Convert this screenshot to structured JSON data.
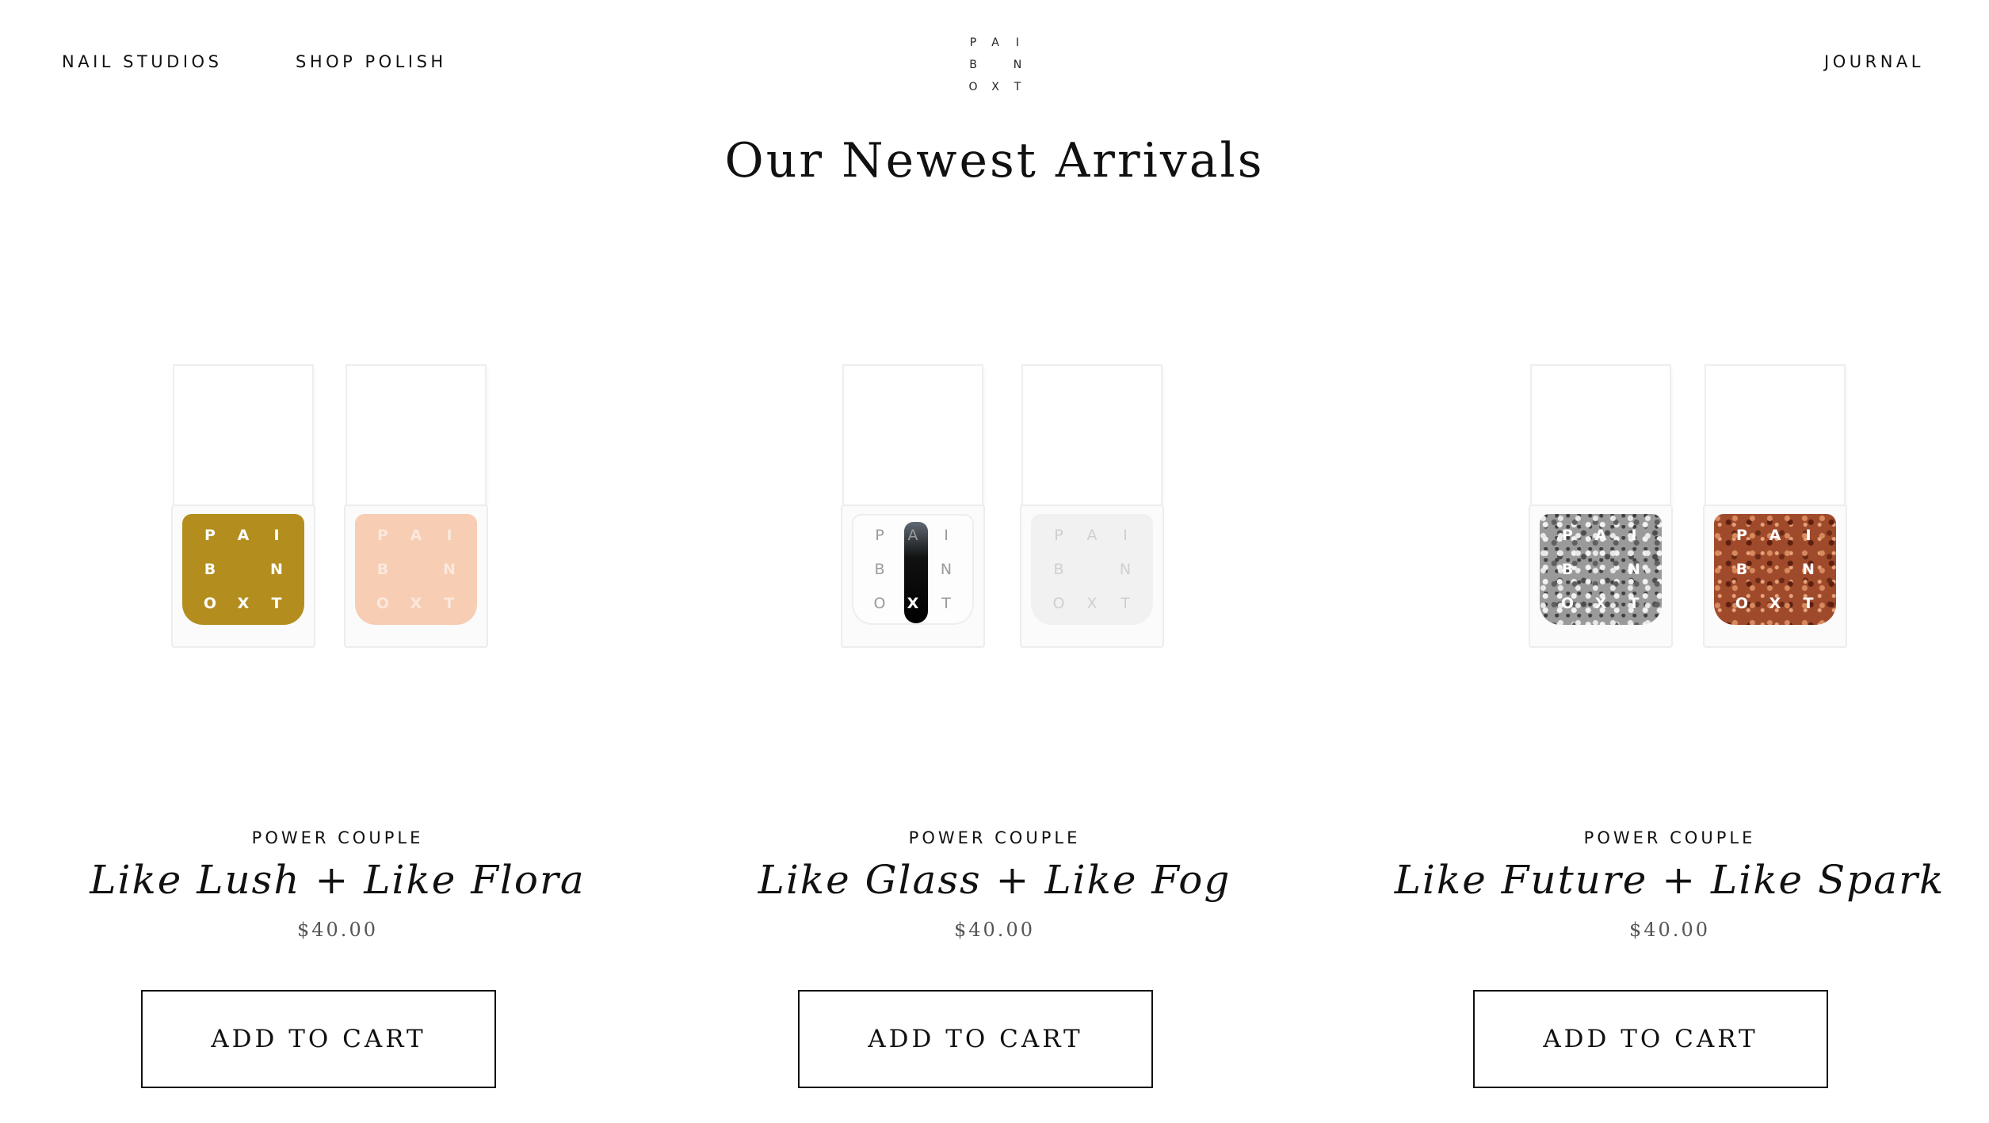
{
  "nav": {
    "left": [
      "NAIL STUDIOS",
      "SHOP POLISH"
    ],
    "right": "JOURNAL"
  },
  "logo": {
    "rows": [
      [
        "P",
        "A",
        "I"
      ],
      [
        "B",
        "",
        "N"
      ],
      [
        "O",
        "X",
        "T"
      ]
    ]
  },
  "page_title": "Our Newest Arrivals",
  "products": [
    {
      "collection": "POWER COUPLE",
      "name": "Like Lush + Like Flora",
      "price": "$40.00",
      "button": "ADD TO CART",
      "bottles": [
        {
          "color": "#b38e1f",
          "label_letters": "PAI B N OXT"
        },
        {
          "color": "#f7cdb3",
          "label_letters": "PAI B N OXT"
        }
      ]
    },
    {
      "collection": "POWER COUPLE",
      "name": "Like Glass + Like Fog",
      "price": "$40.00",
      "button": "ADD TO CART",
      "bottles": [
        {
          "color": "#fdfdfd",
          "label_letters": "PAI B N OXT"
        },
        {
          "color": "#f1f1f1",
          "label_letters": "PAI B N OXT"
        }
      ]
    },
    {
      "collection": "POWER COUPLE",
      "name": "Like Future + Like Spark",
      "price": "$40.00",
      "button": "ADD TO CART",
      "bottles": [
        {
          "color": "#9a9a9a",
          "label_letters": "PAI B N OXT"
        },
        {
          "color": "#a04a2c",
          "label_letters": "PAI B N OXT"
        }
      ]
    }
  ]
}
